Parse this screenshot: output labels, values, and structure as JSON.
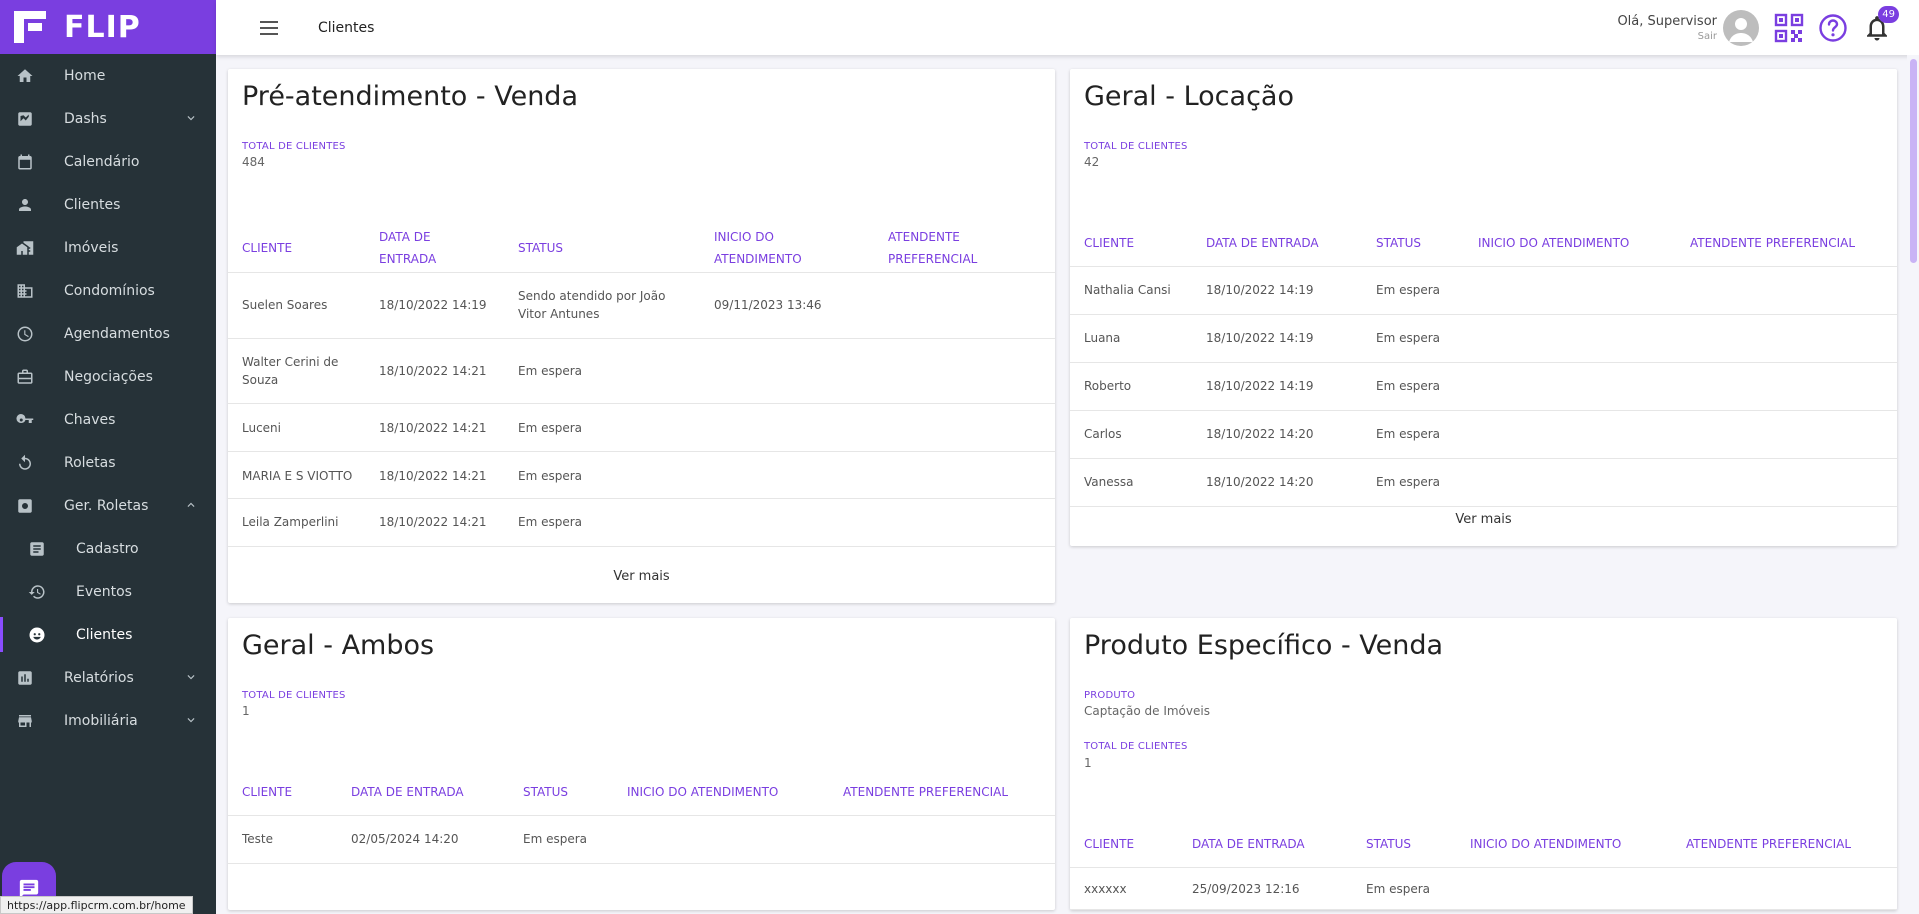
{
  "brand": {
    "name": "FLIP",
    "color": "#7a3ee0"
  },
  "sidebar": {
    "items": [
      {
        "label": "Home",
        "icon": "home-icon"
      },
      {
        "label": "Dashs",
        "icon": "chart-icon",
        "chevron": "down"
      },
      {
        "label": "Calendário",
        "icon": "calendar-icon"
      },
      {
        "label": "Clientes",
        "icon": "person-icon"
      },
      {
        "label": "Imóveis",
        "icon": "house-icon"
      },
      {
        "label": "Condomínios",
        "icon": "building-icon"
      },
      {
        "label": "Agendamentos",
        "icon": "clock-icon"
      },
      {
        "label": "Negociações",
        "icon": "briefcase-icon"
      },
      {
        "label": "Chaves",
        "icon": "key-icon"
      },
      {
        "label": "Roletas",
        "icon": "rotate-icon"
      },
      {
        "label": "Ger. Roletas",
        "icon": "gear-box-icon",
        "chevron": "up"
      },
      {
        "label": "Cadastro",
        "icon": "form-icon",
        "sub": true
      },
      {
        "label": "Eventos",
        "icon": "history-icon",
        "sub": true
      },
      {
        "label": "Clientes",
        "icon": "face-icon",
        "sub": true,
        "active": true
      },
      {
        "label": "Relatórios",
        "icon": "report-icon",
        "chevron": "down"
      },
      {
        "label": "Imobiliária",
        "icon": "store-icon",
        "chevron": "down"
      }
    ]
  },
  "topbar": {
    "title": "Clientes",
    "greeting": "Olá, Supervisor",
    "logout": "Sair",
    "notification_count": "49"
  },
  "status_url": "https://app.flipcrm.com.br/home",
  "cards": {
    "pre_venda": {
      "title": "Pré-atendimento - Venda",
      "total_label": "TOTAL DE CLIENTES",
      "total_value": "484",
      "columns": [
        "CLIENTE",
        "DATA DE ENTRADA",
        "STATUS",
        "INICIO DO ATENDIMENTO",
        "ATENDENTE PREFERENCIAL"
      ],
      "rows": [
        [
          "Suelen Soares",
          "18/10/2022 14:19",
          "Sendo atendido por João Vitor Antunes",
          "09/11/2023 13:46",
          ""
        ],
        [
          "Walter Cerini de Souza",
          "18/10/2022 14:21",
          "Em espera",
          "",
          ""
        ],
        [
          "Luceni",
          "18/10/2022 14:21",
          "Em espera",
          "",
          ""
        ],
        [
          "MARIA E S VIOTTO",
          "18/10/2022 14:21",
          "Em espera",
          "",
          ""
        ],
        [
          "Leila Zamperlini",
          "18/10/2022 14:21",
          "Em espera",
          "",
          ""
        ]
      ],
      "see_more": "Ver mais"
    },
    "geral_locacao": {
      "title": "Geral - Locação",
      "total_label": "TOTAL DE CLIENTES",
      "total_value": "42",
      "columns": [
        "CLIENTE",
        "DATA DE ENTRADA",
        "STATUS",
        "INICIO DO ATENDIMENTO",
        "ATENDENTE PREFERENCIAL"
      ],
      "rows": [
        [
          "Nathalia Cansi",
          "18/10/2022 14:19",
          "Em espera",
          "",
          ""
        ],
        [
          "Luana",
          "18/10/2022 14:19",
          "Em espera",
          "",
          ""
        ],
        [
          "Roberto",
          "18/10/2022 14:19",
          "Em espera",
          "",
          ""
        ],
        [
          "Carlos",
          "18/10/2022 14:20",
          "Em espera",
          "",
          ""
        ],
        [
          "Vanessa",
          "18/10/2022 14:20",
          "Em espera",
          "",
          ""
        ]
      ],
      "see_more": "Ver mais"
    },
    "geral_ambos": {
      "title": "Geral - Ambos",
      "total_label": "TOTAL DE CLIENTES",
      "total_value": "1",
      "columns": [
        "CLIENTE",
        "DATA DE ENTRADA",
        "STATUS",
        "INICIO DO ATENDIMENTO",
        "ATENDENTE PREFERENCIAL"
      ],
      "rows": [
        [
          "Teste",
          "02/05/2024 14:20",
          "Em espera",
          "",
          ""
        ]
      ]
    },
    "produto_venda": {
      "title": "Produto Específico - Venda",
      "product_label": "PRODUTO",
      "product_value": "Captação de Imóveis",
      "total_label": "TOTAL DE CLIENTES",
      "total_value": "1",
      "columns": [
        "CLIENTE",
        "DATA DE ENTRADA",
        "STATUS",
        "INICIO DO ATENDIMENTO",
        "ATENDENTE PREFERENCIAL"
      ],
      "rows": [
        [
          "xxxxxx",
          "25/09/2023 12:16",
          "Em espera",
          "",
          ""
        ]
      ]
    }
  }
}
